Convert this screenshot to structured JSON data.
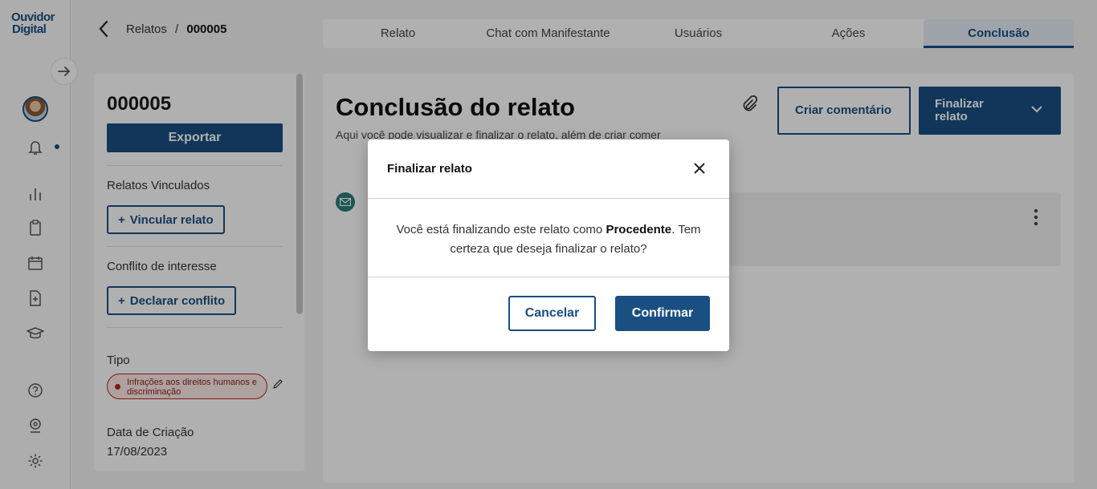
{
  "app": {
    "logo_line1": "Ouvidor",
    "logo_line2": "Digital"
  },
  "rail": {
    "icons": [
      "expand-arrow-icon",
      "bell-icon",
      "chart-icon",
      "clipboard-icon",
      "calendar-icon",
      "file-plus-icon",
      "graduation-cap-icon",
      "help-icon",
      "webcam-icon",
      "settings-icon"
    ]
  },
  "breadcrumb": {
    "parent": "Relatos",
    "separator": "/",
    "current": "000005"
  },
  "tabs": [
    {
      "label": "Relato"
    },
    {
      "label": "Chat com Manifestante"
    },
    {
      "label": "Usuários"
    },
    {
      "label": "Ações"
    },
    {
      "label": "Conclusão"
    }
  ],
  "sidebar": {
    "id": "000005",
    "export_label": "Exportar",
    "linked_title": "Relatos Vinculados",
    "link_button": "Vincular relato",
    "conflict_title": "Conflito de interesse",
    "conflict_button": "Declarar conflito",
    "type_title": "Tipo",
    "type_tag": "Infrações aos direitos humanos e discriminação",
    "created_title": "Data de Criação",
    "created_value": "17/08/2023"
  },
  "main": {
    "title": "Conclusão do relato",
    "description": "Aqui você pode visualizar e finalizar o relato, além de criar comer",
    "comment_button": "Criar comentário",
    "finalize_button": "Finalizar relato"
  },
  "modal": {
    "title": "Finalizar relato",
    "message_prefix": "Você está finalizando este relato como ",
    "message_emphasis": "Procedente",
    "message_suffix": ". Tem certeza que deseja finalizar o relato?",
    "cancel_label": "Cancelar",
    "confirm_label": "Confirmar"
  },
  "colors": {
    "primary": "#1a4f82",
    "tag_border": "#b3261e",
    "mail_icon": "#2a7d7b"
  }
}
